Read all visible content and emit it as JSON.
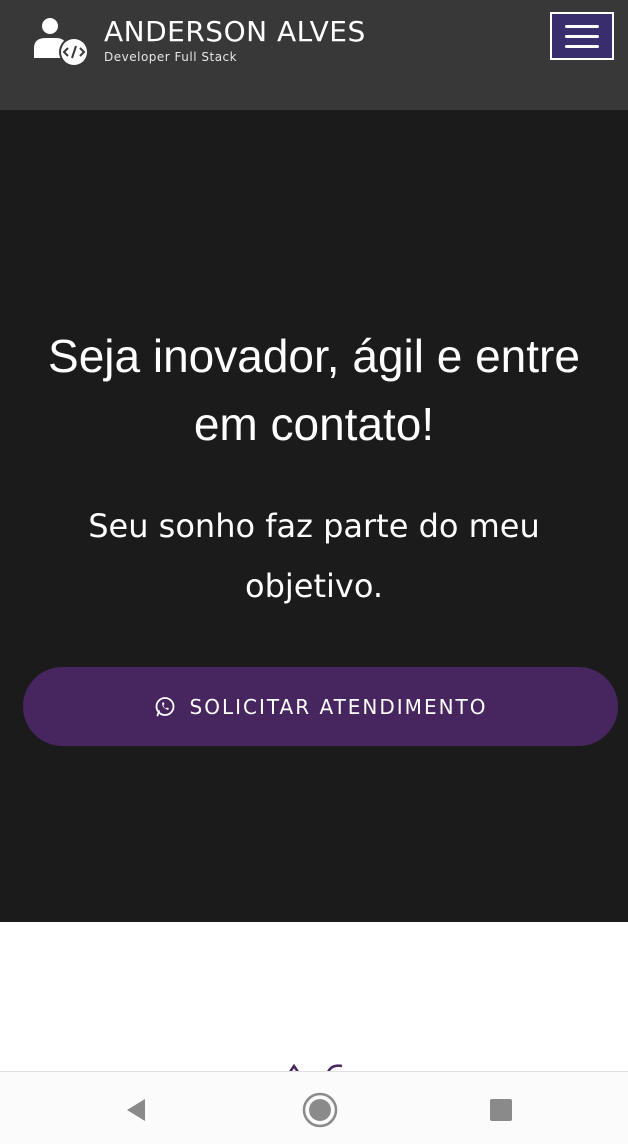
{
  "header": {
    "brand_name": "ANDERSON ALVES",
    "brand_tagline": "Developer Full Stack",
    "logo_icon": "developer-user-code-icon",
    "menu_icon": "hamburger-menu-icon",
    "menu_button_color": "#3a2d6d",
    "background_color": "#383838"
  },
  "hero": {
    "title": "Seja inovador, ágil e entre em contato!",
    "subtitle": "Seu sonho faz parte do meu objetivo.",
    "background_color": "#1b1b1b",
    "cta": {
      "label": "SOLICITAR ATENDIMENTO",
      "icon": "whatsapp-icon",
      "color": "#472660"
    }
  },
  "system_nav": {
    "back_icon": "back-triangle-icon",
    "home_icon": "home-circle-icon",
    "recents_icon": "recents-square-icon"
  }
}
